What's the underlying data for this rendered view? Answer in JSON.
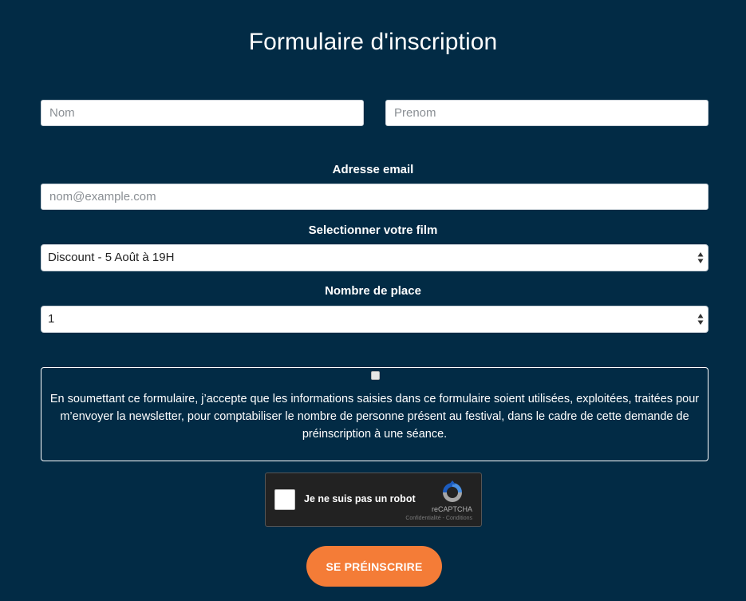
{
  "form": {
    "title": "Formulaire d'inscription",
    "nom": {
      "placeholder": "Nom",
      "value": ""
    },
    "prenom": {
      "placeholder": "Prenom",
      "value": ""
    },
    "email": {
      "label": "Adresse email",
      "placeholder": "nom@example.com",
      "value": ""
    },
    "film": {
      "label": "Selectionner votre film",
      "selected": "Discount - 5 Août à 19H"
    },
    "places": {
      "label": "Nombre de place",
      "selected": "1"
    },
    "consent": {
      "checked": false,
      "text": "En soumettant ce formulaire, j’accepte que les informations saisies dans ce formulaire soient utilisées, exploitées, traitées pour m’envoyer la newsletter, pour comptabiliser le nombre de personne présent au festival, dans le cadre de cette demande de préinscription à une séance."
    },
    "recaptcha": {
      "label": "Je ne suis pas un robot",
      "brand": "reCAPTCHA",
      "links": "Confidentialité - Conditions",
      "checked": false
    },
    "submit_label": "SE PRÉINSCRIRE"
  },
  "colors": {
    "background": "#022b45",
    "accent": "#f47c37"
  },
  "icons": {
    "select_arrows": "up-down-arrows-icon",
    "recaptcha_logo": "recaptcha-logo-icon"
  }
}
